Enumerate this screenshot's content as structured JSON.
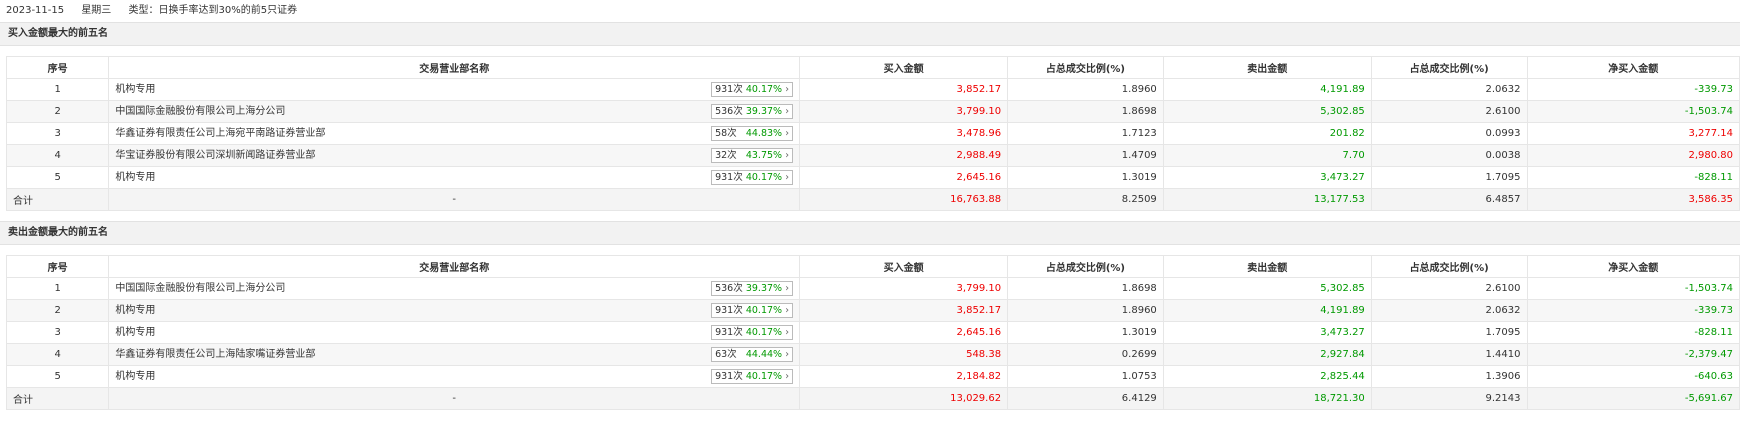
{
  "header": {
    "date": "2023-11-15",
    "weekday": "星期三",
    "type_label": "类型：日换手率达到30%的前5只证券"
  },
  "columns": [
    "序号",
    "交易营业部名称",
    "买入金额",
    "占总成交比例(%)",
    "卖出金额",
    "占总成交比例(%)",
    "净买入金额"
  ],
  "buy_section": {
    "title": "买入金额最大的前五名",
    "rows": [
      {
        "idx": "1",
        "name": "机构专用",
        "count": "931次",
        "pct": "40.17%",
        "buy": "3,852.17",
        "buy_pct": "1.8960",
        "sell": "4,191.89",
        "sell_pct": "2.0632",
        "net": "-339.73",
        "net_color": "green"
      },
      {
        "idx": "2",
        "name": "中国国际金融股份有限公司上海分公司",
        "count": "536次",
        "pct": "39.37%",
        "buy": "3,799.10",
        "buy_pct": "1.8698",
        "sell": "5,302.85",
        "sell_pct": "2.6100",
        "net": "-1,503.74",
        "net_color": "green"
      },
      {
        "idx": "3",
        "name": "华鑫证券有限责任公司上海宛平南路证券营业部",
        "count": "58次",
        "pct": "44.83%",
        "buy": "3,478.96",
        "buy_pct": "1.7123",
        "sell": "201.82",
        "sell_pct": "0.0993",
        "net": "3,277.14",
        "net_color": "red"
      },
      {
        "idx": "4",
        "name": "华宝证券股份有限公司深圳新闻路证券营业部",
        "count": "32次",
        "pct": "43.75%",
        "buy": "2,988.49",
        "buy_pct": "1.4709",
        "sell": "7.70",
        "sell_pct": "0.0038",
        "net": "2,980.80",
        "net_color": "red"
      },
      {
        "idx": "5",
        "name": "机构专用",
        "count": "931次",
        "pct": "40.17%",
        "buy": "2,645.16",
        "buy_pct": "1.3019",
        "sell": "3,473.27",
        "sell_pct": "1.7095",
        "net": "-828.11",
        "net_color": "green"
      }
    ],
    "total": {
      "label": "合计",
      "name": "-",
      "buy": "16,763.88",
      "buy_pct": "8.2509",
      "sell": "13,177.53",
      "sell_pct": "6.4857",
      "net": "3,586.35",
      "net_color": "red"
    }
  },
  "sell_section": {
    "title": "卖出金额最大的前五名",
    "rows": [
      {
        "idx": "1",
        "name": "中国国际金融股份有限公司上海分公司",
        "count": "536次",
        "pct": "39.37%",
        "buy": "3,799.10",
        "buy_pct": "1.8698",
        "sell": "5,302.85",
        "sell_pct": "2.6100",
        "net": "-1,503.74",
        "net_color": "green"
      },
      {
        "idx": "2",
        "name": "机构专用",
        "count": "931次",
        "pct": "40.17%",
        "buy": "3,852.17",
        "buy_pct": "1.8960",
        "sell": "4,191.89",
        "sell_pct": "2.0632",
        "net": "-339.73",
        "net_color": "green"
      },
      {
        "idx": "3",
        "name": "机构专用",
        "count": "931次",
        "pct": "40.17%",
        "buy": "2,645.16",
        "buy_pct": "1.3019",
        "sell": "3,473.27",
        "sell_pct": "1.7095",
        "net": "-828.11",
        "net_color": "green"
      },
      {
        "idx": "4",
        "name": "华鑫证券有限责任公司上海陆家嘴证券营业部",
        "count": "63次",
        "pct": "44.44%",
        "buy": "548.38",
        "buy_pct": "0.2699",
        "sell": "2,927.84",
        "sell_pct": "1.4410",
        "net": "-2,379.47",
        "net_color": "green"
      },
      {
        "idx": "5",
        "name": "机构专用",
        "count": "931次",
        "pct": "40.17%",
        "buy": "2,184.82",
        "buy_pct": "1.0753",
        "sell": "2,825.44",
        "sell_pct": "1.3906",
        "net": "-640.63",
        "net_color": "green"
      }
    ],
    "total": {
      "label": "合计",
      "name": "-",
      "buy": "13,029.62",
      "buy_pct": "6.4129",
      "sell": "18,721.30",
      "sell_pct": "9.2143",
      "net": "-5,691.67",
      "net_color": "green"
    }
  },
  "colors": {
    "red": "#e00000",
    "green": "#009900"
  }
}
